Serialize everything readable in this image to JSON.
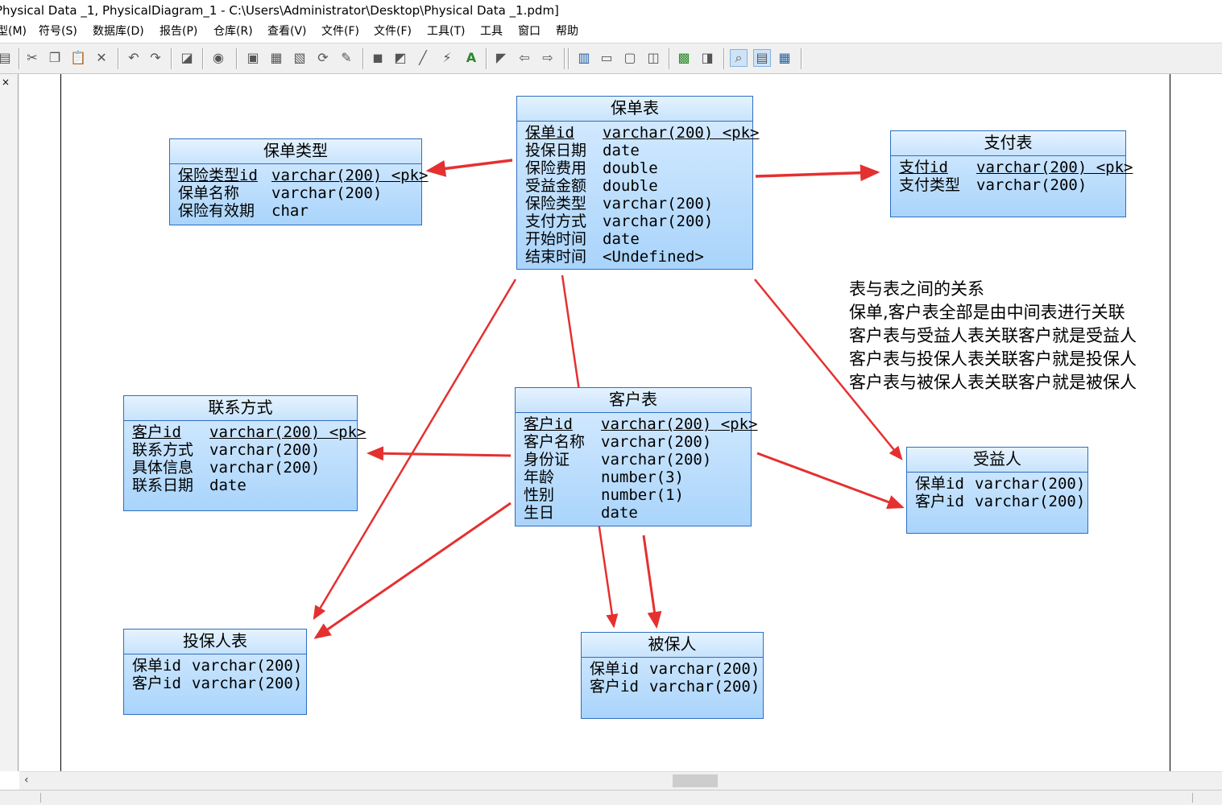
{
  "window": {
    "title": "Physical Data _1, PhysicalDiagram_1 - C:\\Users\\Administrator\\Desktop\\Physical Data _1.pdm]"
  },
  "menu": [
    {
      "label": "型(M)"
    },
    {
      "label": "符号(S)"
    },
    {
      "label": "数据库(D)"
    },
    {
      "label": "报告(P)"
    },
    {
      "label": "仓库(R)"
    },
    {
      "label": "查看(V)"
    },
    {
      "label": "文件(F)"
    },
    {
      "label": "文件(F)"
    },
    {
      "label": "工具(T)"
    },
    {
      "label": "工具"
    },
    {
      "label": "窗口"
    },
    {
      "label": "帮助"
    }
  ],
  "left_panel": {
    "close_glyph": "×"
  },
  "tables": {
    "policy": {
      "name": "保单表",
      "columns": [
        {
          "name": "保单id",
          "type": "varchar(200) <pk>",
          "pk": true
        },
        {
          "name": "投保日期",
          "type": "date"
        },
        {
          "name": "保险费用",
          "type": "double"
        },
        {
          "name": "受益金额",
          "type": "double"
        },
        {
          "name": "保险类型",
          "type": "varchar(200)"
        },
        {
          "name": "支付方式",
          "type": "varchar(200)"
        },
        {
          "name": "开始时间",
          "type": "date"
        },
        {
          "name": "结束时间",
          "type": "<Undefined>"
        }
      ]
    },
    "policy_type": {
      "name": "保单类型",
      "columns": [
        {
          "name": "保险类型id",
          "type": "varchar(200) <pk>",
          "pk": true
        },
        {
          "name": "保单名称",
          "type": "varchar(200)"
        },
        {
          "name": "保险有效期",
          "type": "char"
        }
      ]
    },
    "payment": {
      "name": "支付表",
      "columns": [
        {
          "name": "支付id",
          "type": "varchar(200) <pk>",
          "pk": true
        },
        {
          "name": "支付类型",
          "type": "varchar(200)"
        }
      ]
    },
    "contact": {
      "name": "联系方式",
      "columns": [
        {
          "name": "客户id",
          "type": "varchar(200) <pk>",
          "pk": true
        },
        {
          "name": "联系方式",
          "type": "varchar(200)"
        },
        {
          "name": "具体信息",
          "type": "varchar(200)"
        },
        {
          "name": "联系日期",
          "type": "date"
        }
      ]
    },
    "customer": {
      "name": "客户表",
      "columns": [
        {
          "name": "客户id",
          "type": "varchar(200) <pk>",
          "pk": true
        },
        {
          "name": "客户名称",
          "type": "varchar(200)"
        },
        {
          "name": "身份证",
          "type": "varchar(200)"
        },
        {
          "name": "年龄",
          "type": "number(3)"
        },
        {
          "name": "性别",
          "type": "number(1)"
        },
        {
          "name": "生日",
          "type": "date"
        }
      ]
    },
    "beneficiary": {
      "name": "受益人",
      "columns": [
        {
          "name": "保单id",
          "type": "varchar(200)"
        },
        {
          "name": "客户id",
          "type": "varchar(200)"
        }
      ]
    },
    "policyholder": {
      "name": "投保人表",
      "columns": [
        {
          "name": "保单id",
          "type": "varchar(200)"
        },
        {
          "name": "客户id",
          "type": "varchar(200)"
        }
      ]
    },
    "insured": {
      "name": "被保人",
      "columns": [
        {
          "name": "保单id",
          "type": "varchar(200)"
        },
        {
          "name": "客户id",
          "type": "varchar(200)"
        }
      ]
    }
  },
  "note": {
    "lines": [
      "表与表之间的关系",
      "保单,客户表全部是由中间表进行关联",
      "客户表与受益人表关联客户就是受益人",
      "客户表与投保人表关联客户就是投保人",
      "客户表与被保人表关联客户就是被保人"
    ]
  },
  "colors": {
    "arrow": "#e53030",
    "table_border": "#2f6fbf",
    "table_fill": "#b9dcfb"
  }
}
